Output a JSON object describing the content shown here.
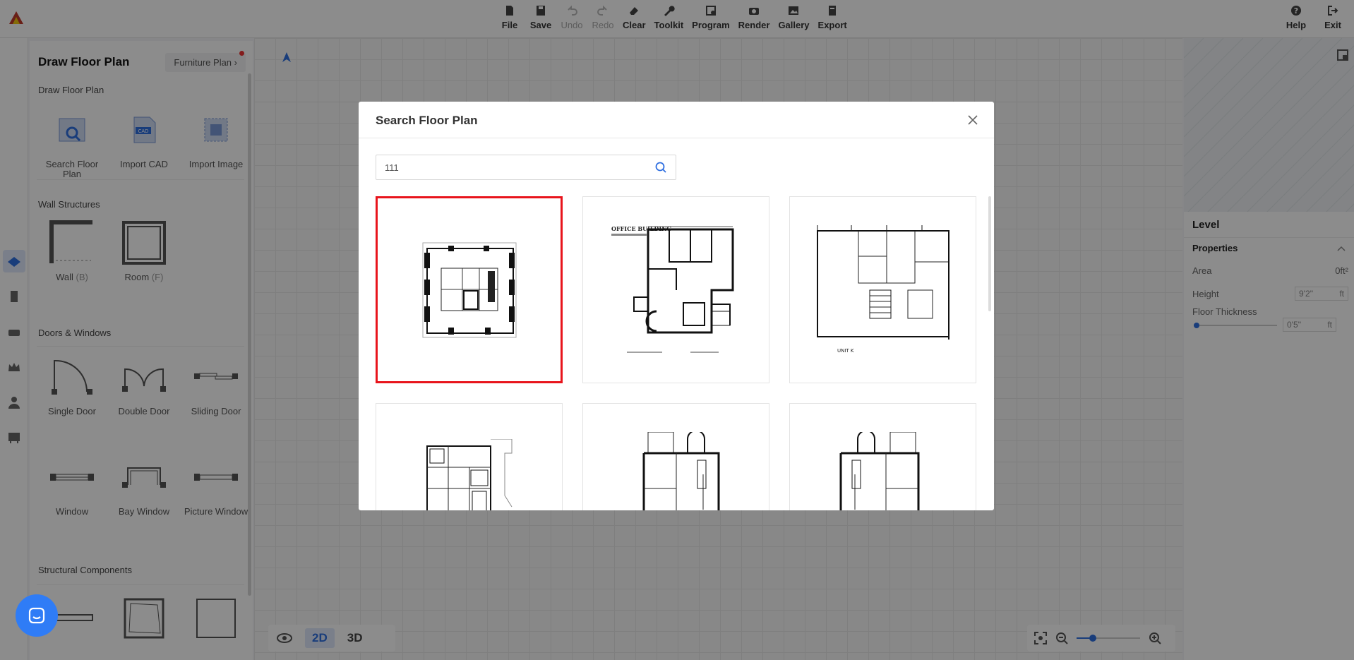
{
  "toolbar": {
    "items": [
      {
        "label": "File",
        "icon": "file-icon"
      },
      {
        "label": "Save",
        "icon": "save-icon"
      },
      {
        "label": "Undo",
        "icon": "undo-icon"
      },
      {
        "label": "Redo",
        "icon": "redo-icon"
      },
      {
        "label": "Clear",
        "icon": "eraser-icon"
      },
      {
        "label": "Toolkit",
        "icon": "wrench-icon"
      },
      {
        "label": "Program",
        "icon": "program-icon"
      },
      {
        "label": "Render",
        "icon": "camera-icon"
      },
      {
        "label": "Gallery",
        "icon": "image-icon"
      },
      {
        "label": "Export",
        "icon": "export-icon"
      }
    ],
    "help_label": "Help",
    "exit_label": "Exit"
  },
  "left_panel": {
    "title": "Draw Floor Plan",
    "tab_label": "Furniture Plan",
    "sections": {
      "draw": "Draw Floor Plan",
      "wall": "Wall Structures",
      "doors": "Doors & Windows",
      "structural": "Structural Components"
    },
    "draw_items": [
      {
        "label": "Search Floor Plan"
      },
      {
        "label": "Import CAD"
      },
      {
        "label": "Import Image"
      }
    ],
    "wall_items": [
      {
        "label": "Wall",
        "key": "(B)"
      },
      {
        "label": "Room",
        "key": "(F)"
      }
    ],
    "door_items": [
      {
        "label": "Single Door"
      },
      {
        "label": "Double Door"
      },
      {
        "label": "Sliding Door"
      },
      {
        "label": "Window"
      },
      {
        "label": "Bay Window"
      },
      {
        "label": "Picture Window"
      }
    ]
  },
  "canvas": {
    "view_2d": "2D",
    "view_3d": "3D",
    "zoom_level": 0.25
  },
  "right_panel": {
    "level_label": "Level",
    "properties_label": "Properties",
    "area_label": "Area",
    "area_value": "0ft²",
    "height_label": "Height",
    "height_value": "9'2''",
    "height_unit": "ft",
    "floor_thickness_label": "Floor Thickness",
    "floor_thickness_value": "0'5''",
    "floor_thickness_unit": "ft"
  },
  "modal": {
    "title": "Search Floor Plan",
    "search_value": "111",
    "results_count": 6
  },
  "colors": {
    "accent": "#2f6fe0",
    "selection": "#e8141c"
  }
}
